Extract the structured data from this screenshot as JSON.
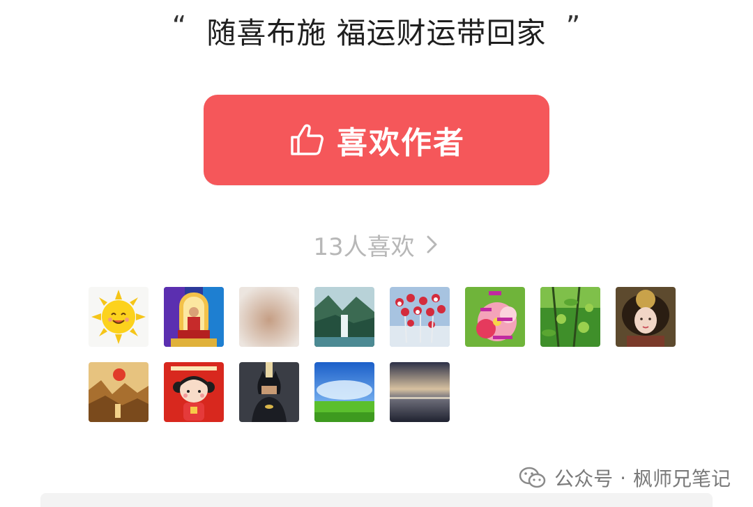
{
  "quote": {
    "open": "“",
    "text": "随喜布施 福运财运带回家",
    "close": "”"
  },
  "like_button": {
    "label": "喜欢作者",
    "icon": "thumbs-up-icon",
    "bg_color": "#f5575a"
  },
  "likes": {
    "count_text": "13人喜欢",
    "icon": "chevron-right-icon"
  },
  "avatars": [
    {
      "name": "avatar-sun"
    },
    {
      "name": "avatar-fantasy-man"
    },
    {
      "name": "avatar-blurred"
    },
    {
      "name": "avatar-waterfall"
    },
    {
      "name": "avatar-flowers"
    },
    {
      "name": "avatar-greeting-card"
    },
    {
      "name": "avatar-green-fruit"
    },
    {
      "name": "avatar-ancient-lady"
    },
    {
      "name": "avatar-sunset-mountains"
    },
    {
      "name": "avatar-cartoon-girl"
    },
    {
      "name": "avatar-batman"
    },
    {
      "name": "avatar-sky-meadow"
    },
    {
      "name": "avatar-dusk-beach"
    }
  ],
  "footer": {
    "account_type": "公众号",
    "separator": "·",
    "account_name": "枫师兄笔记",
    "icon": "wechat-icon"
  }
}
